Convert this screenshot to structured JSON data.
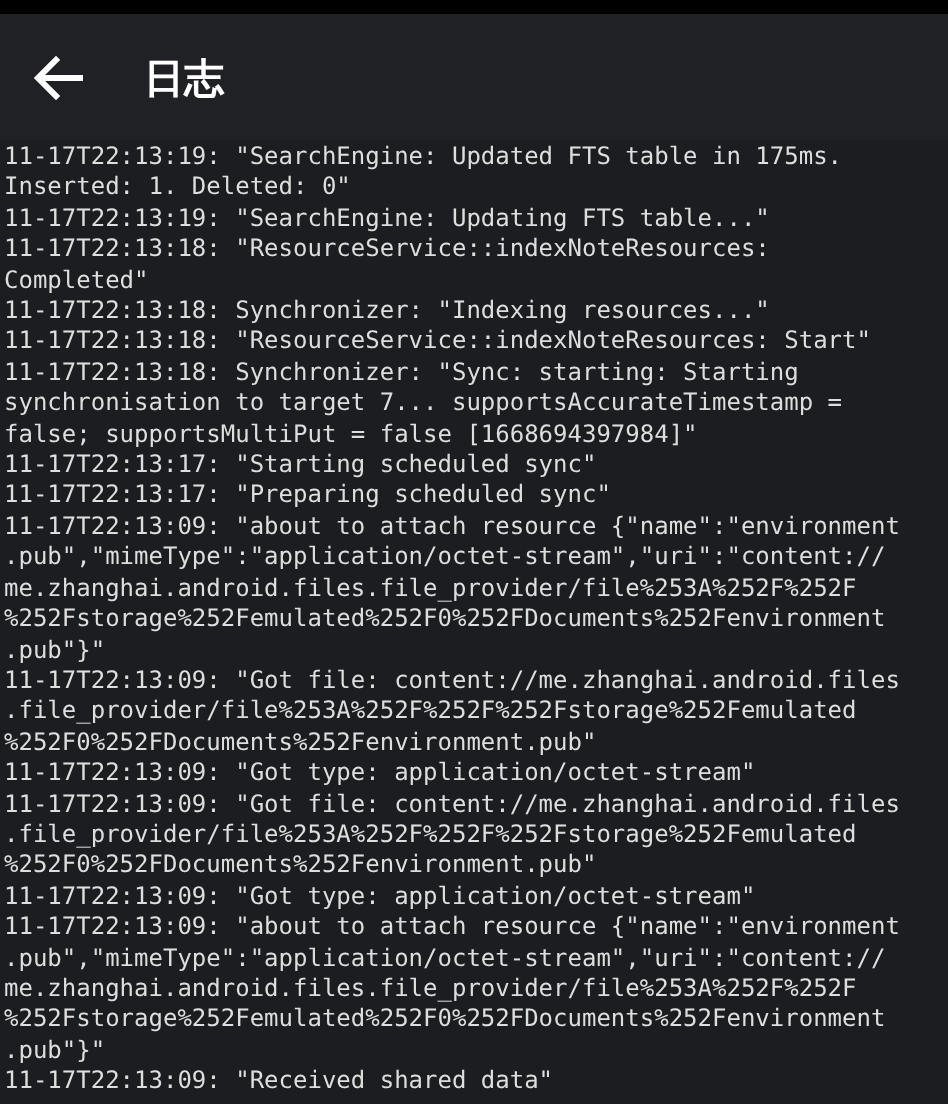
{
  "app_bar": {
    "title": "日志"
  },
  "log_entries": [
    {
      "lines": [
        "11-17T22:13:19: \"SearchEngine: Updated FTS table in 175ms.",
        "Inserted: 1. Deleted: 0\""
      ]
    },
    {
      "lines": [
        "11-17T22:13:19: \"SearchEngine: Updating FTS table...\""
      ]
    },
    {
      "lines": [
        "11-17T22:13:18: \"ResourceService::indexNoteResources:",
        "Completed\""
      ]
    },
    {
      "lines": [
        "11-17T22:13:18: Synchronizer: \"Indexing resources...\""
      ]
    },
    {
      "lines": [
        "11-17T22:13:18: \"ResourceService::indexNoteResources: Start\""
      ]
    },
    {
      "lines": [
        "11-17T22:13:18: Synchronizer: \"Sync: starting: Starting",
        "synchronisation to target 7... supportsAccurateTimestamp =",
        "false; supportsMultiPut = false [1668694397984]\""
      ]
    },
    {
      "lines": [
        "11-17T22:13:17: \"Starting scheduled sync\""
      ]
    },
    {
      "lines": [
        "11-17T22:13:17: \"Preparing scheduled sync\""
      ]
    },
    {
      "lines": [
        "11-17T22:13:09: \"about to attach resource {\"name\":\"environment",
        ".pub\",\"mimeType\":\"application/octet-stream\",\"uri\":\"content://",
        "me.zhanghai.android.files.file_provider/file%253A%252F%252F",
        "%252Fstorage%252Femulated%252F0%252FDocuments%252Fenvironment",
        ".pub\"}\""
      ]
    },
    {
      "lines": [
        "11-17T22:13:09: \"Got file: content://me.zhanghai.android.files",
        ".file_provider/file%253A%252F%252F%252Fstorage%252Femulated",
        "%252F0%252FDocuments%252Fenvironment.pub\""
      ]
    },
    {
      "lines": [
        "11-17T22:13:09: \"Got type: application/octet-stream\""
      ]
    },
    {
      "lines": [
        "11-17T22:13:09: \"Got file: content://me.zhanghai.android.files",
        ".file_provider/file%253A%252F%252F%252Fstorage%252Femulated",
        "%252F0%252FDocuments%252Fenvironment.pub\""
      ]
    },
    {
      "lines": [
        "11-17T22:13:09: \"Got type: application/octet-stream\""
      ]
    },
    {
      "lines": [
        "11-17T22:13:09: \"about to attach resource {\"name\":\"environment",
        ".pub\",\"mimeType\":\"application/octet-stream\",\"uri\":\"content://",
        "me.zhanghai.android.files.file_provider/file%253A%252F%252F",
        "%252Fstorage%252Femulated%252F0%252FDocuments%252Fenvironment",
        ".pub\"}\""
      ]
    },
    {
      "lines": [
        "11-17T22:13:09: \"Received shared data\""
      ]
    }
  ]
}
